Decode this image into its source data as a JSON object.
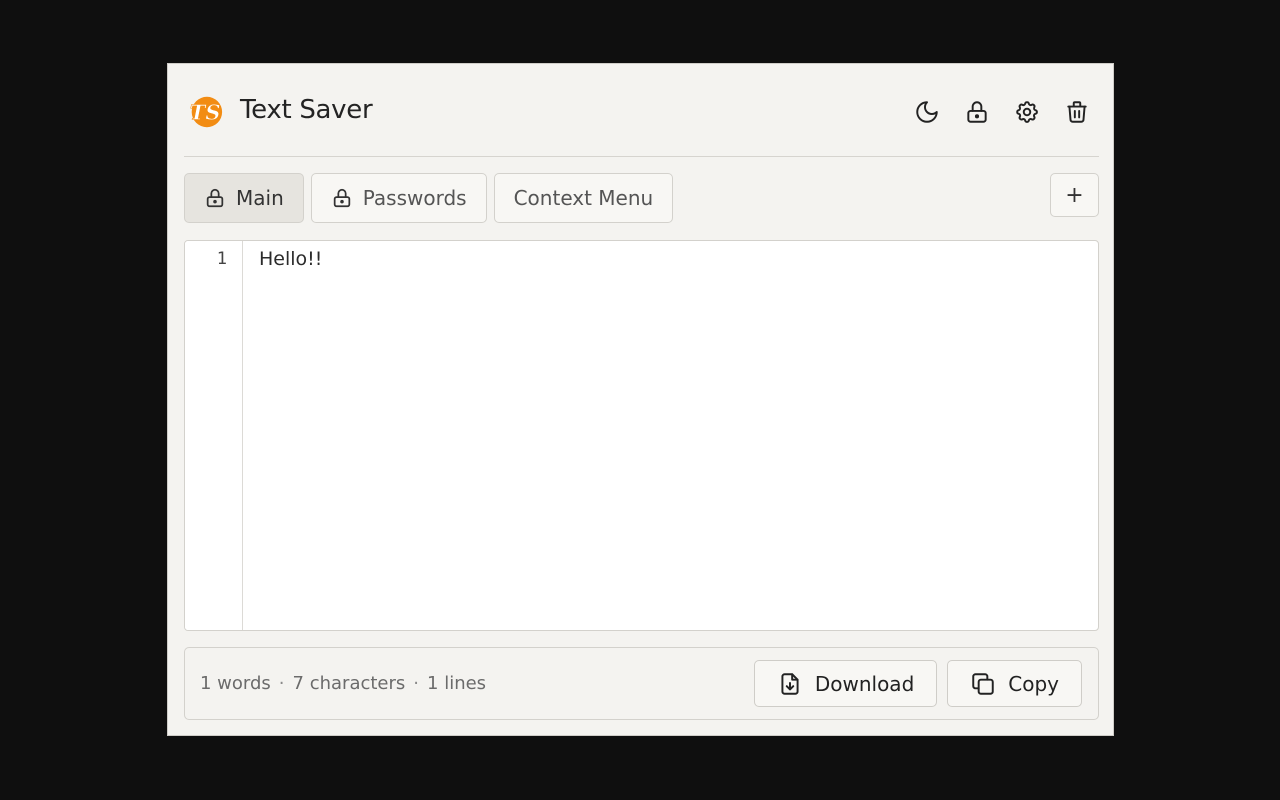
{
  "app": {
    "title": "Text Saver",
    "logo_text": "TS",
    "accent_color": "#f28c13"
  },
  "header": {
    "actions": [
      {
        "name": "theme-toggle",
        "icon": "moon-icon"
      },
      {
        "name": "lock",
        "icon": "lock-icon"
      },
      {
        "name": "settings",
        "icon": "gear-icon"
      },
      {
        "name": "delete",
        "icon": "trash-icon"
      }
    ]
  },
  "tabs": [
    {
      "label": "Main",
      "icon": "lock-icon",
      "active": true
    },
    {
      "label": "Passwords",
      "icon": "lock-icon",
      "active": false
    },
    {
      "label": "Context Menu",
      "icon": null,
      "active": false
    }
  ],
  "add_tab_label": "+",
  "editor": {
    "line_numbers": [
      "1"
    ],
    "lines": [
      "Hello!!"
    ]
  },
  "footer": {
    "words": "1 words",
    "characters": "7 characters",
    "lines": "1 lines",
    "separator": "·",
    "download_label": "Download",
    "copy_label": "Copy"
  }
}
